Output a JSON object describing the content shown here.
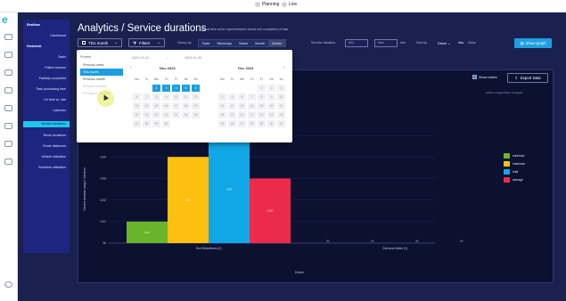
{
  "topbar": {
    "planning": "Planning",
    "live": "Live"
  },
  "logo": "e",
  "sidebar": {
    "items": [
      {
        "label": "Realtime",
        "head": true
      },
      {
        "label": "Dashboard"
      },
      {
        "label": "Historical",
        "head": true
      },
      {
        "label": "Tasks"
      },
      {
        "label": "Failed reasons"
      },
      {
        "label": "Partially completed"
      },
      {
        "label": "Task processing time"
      },
      {
        "label": "On time vs. late"
      },
      {
        "label": "Lateness"
      },
      {
        "label": "Service durations",
        "active": true
      },
      {
        "label": "Route durations"
      },
      {
        "label": "Route distances"
      },
      {
        "label": "Vehicle utilization"
      },
      {
        "label": "Schedule utilization"
      }
    ]
  },
  "header": {
    "title": "Analytics / Service durations",
    "subtitle": "Actual time driver spent between arrival and completion of task"
  },
  "toolbar": {
    "date_button": "This month",
    "filters_button": "Filters",
    "group_by_label": "Group by",
    "group_by_options": [
      "Date",
      "Weekday",
      "Week",
      "Month",
      "Driver"
    ],
    "group_by_selected": "Driver",
    "service_duration_label": "Service duration",
    "min_placeholder": "Min",
    "max_placeholder": "Max",
    "unit": "min",
    "sort_by_label": "Sort by",
    "sort_by_value": "Driver",
    "sort_asc": "Asc",
    "sort_desc": "Desc",
    "show_graph": "Show graph"
  },
  "panel": {
    "show_tables": "Show tables",
    "export": "Export Data",
    "hint": "(Click on legend item to toggle)"
  },
  "date_popup": {
    "presets_header": "Presets",
    "presets": [
      "Previous week",
      "This month",
      "Previous month",
      "Previous months",
      "Previous 3 months"
    ],
    "preset_selected": "This month",
    "range_start": "2023-11-01",
    "range_end": "2023-11-30",
    "weekday_headers": [
      "Mo",
      "Tu",
      "We",
      "Th",
      "Fr",
      "Sa",
      "Su"
    ],
    "left_month": "Nov 2023",
    "right_month": "Dec 2023",
    "left_days": [
      "",
      "",
      "1",
      "2",
      "3",
      "4",
      "5",
      "6",
      "7",
      "8",
      "9",
      "10",
      "11",
      "12",
      "13",
      "14",
      "15",
      "16",
      "17",
      "18",
      "19",
      "20",
      "21",
      "22",
      "23",
      "24",
      "25",
      "26",
      "27",
      "28",
      "29",
      "30"
    ],
    "right_days": [
      "",
      "",
      "",
      "",
      "1",
      "2",
      "3",
      "4",
      "5",
      "6",
      "7",
      "8",
      "9",
      "10",
      "11",
      "12",
      "13",
      "14",
      "15",
      "16",
      "17",
      "18",
      "19",
      "20",
      "21",
      "22",
      "23",
      "24",
      "25",
      "26",
      "27",
      "28",
      "29",
      "30",
      "31"
    ],
    "selected_days": [
      "1",
      "2",
      "3",
      "4",
      "5"
    ]
  },
  "chart_data": {
    "type": "bar",
    "categories": [
      "Toni Klicksthrom (2)",
      "Chenera Delete (1)"
    ],
    "series": [
      {
        "name": "minimum",
        "color": "#6ab42b",
        "values": [
          0.01,
          null
        ],
        "labels": [
          "0.01",
          "0s"
        ]
      },
      {
        "name": "maximum",
        "color": "#fdbf10",
        "values": [
          0.04,
          null
        ],
        "labels": [
          "0.02",
          "0s"
        ]
      },
      {
        "name": "total",
        "color": "#11a7e6",
        "values": [
          0.05,
          null
        ],
        "labels": [
          "0.05",
          "0s"
        ]
      },
      {
        "name": "average",
        "color": "#ee2a4a",
        "values": [
          0.03,
          null
        ],
        "labels": [
          "0.02",
          "0s"
        ]
      }
    ],
    "ylabel": "Service duration (avg in minutes)",
    "xlabel": "Driver",
    "y_ticks": [
      "0s",
      "0.01",
      "0.02",
      "0.03",
      "0.04",
      "0.05"
    ],
    "ylim": [
      0,
      0.05
    ],
    "legend_position": "right"
  }
}
